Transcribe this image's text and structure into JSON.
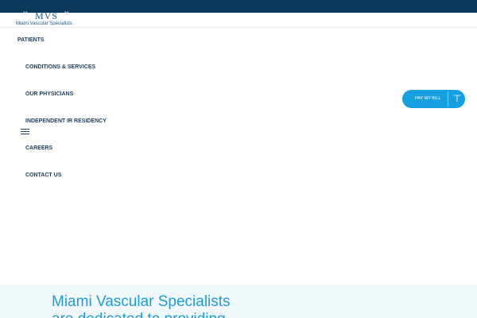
{
  "header": {
    "logo_text": "MVS",
    "logo_tagline": "Miami Vascular Specialists"
  },
  "nav": {
    "items": [
      {
        "label": "PATIENTS"
      },
      {
        "label": "CONDITIONS & SERVICES"
      },
      {
        "label": "OUR PHYSICIANS"
      },
      {
        "label": "INDEPENDENT IR RESIDENCY"
      },
      {
        "label": "CAREERS"
      },
      {
        "label": "CONTACT US"
      }
    ]
  },
  "pay_bill": {
    "label": "PAY MY BILL",
    "icon": "arrow-up-icon"
  },
  "hero": {
    "title_line1": "Miami Vascular Specialists",
    "title_line2": "are dedicated to providing"
  },
  "colors": {
    "topbar": "#0b3a5c",
    "accent": "#17a0e0",
    "nav_text": "#1f3f5c",
    "hero_bg": "#f0f8fb"
  }
}
